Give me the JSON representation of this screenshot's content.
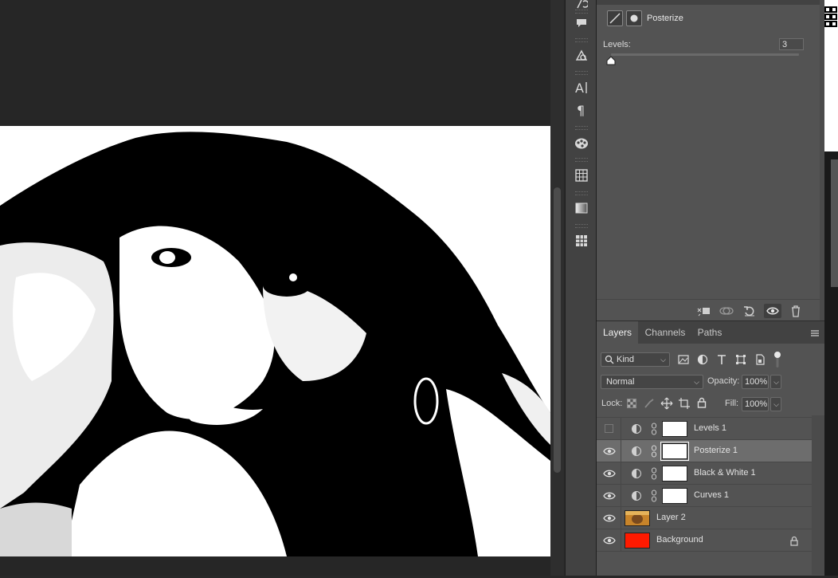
{
  "properties": {
    "title": "Posterize",
    "levels_label": "Levels:",
    "levels_value": "3",
    "levels_slider_fraction": 0.0
  },
  "layers_panel": {
    "tabs": [
      {
        "label": "Layers",
        "active": true
      },
      {
        "label": "Channels",
        "active": false
      },
      {
        "label": "Paths",
        "active": false
      }
    ],
    "filter_kind": "Kind",
    "blend_mode": "Normal",
    "opacity_label": "Opacity:",
    "opacity_value": "100%",
    "lock_label": "Lock:",
    "fill_label": "Fill:",
    "fill_value": "100%",
    "layers": [
      {
        "name": "Levels 1",
        "visible": false,
        "type": "adjustment",
        "selected": false
      },
      {
        "name": "Posterize 1",
        "visible": true,
        "type": "adjustment",
        "selected": true
      },
      {
        "name": "Black & White 1",
        "visible": true,
        "type": "adjustment",
        "selected": false
      },
      {
        "name": "Curves 1",
        "visible": true,
        "type": "adjustment",
        "selected": false
      },
      {
        "name": "Layer 2",
        "visible": true,
        "type": "pixel",
        "selected": false
      },
      {
        "name": "Background",
        "visible": true,
        "type": "background",
        "selected": false,
        "locked": true
      }
    ]
  },
  "colors": {
    "background_layer": "#ff1a00",
    "panel": "#535353",
    "selected_row": "#6d6d6d"
  },
  "icons": {
    "toolstrip": [
      "brush-settings-icon",
      "comment-icon",
      "clone-source-icon",
      "character-icon",
      "paragraph-icon",
      "swatches-icon",
      "table-grid-icon",
      "gradient-icon",
      "pattern-grid-icon"
    ],
    "properties_footer": [
      "clip-to-layer-icon",
      "view-previous-state-icon",
      "reset-icon",
      "visibility-icon",
      "trash-icon"
    ]
  }
}
